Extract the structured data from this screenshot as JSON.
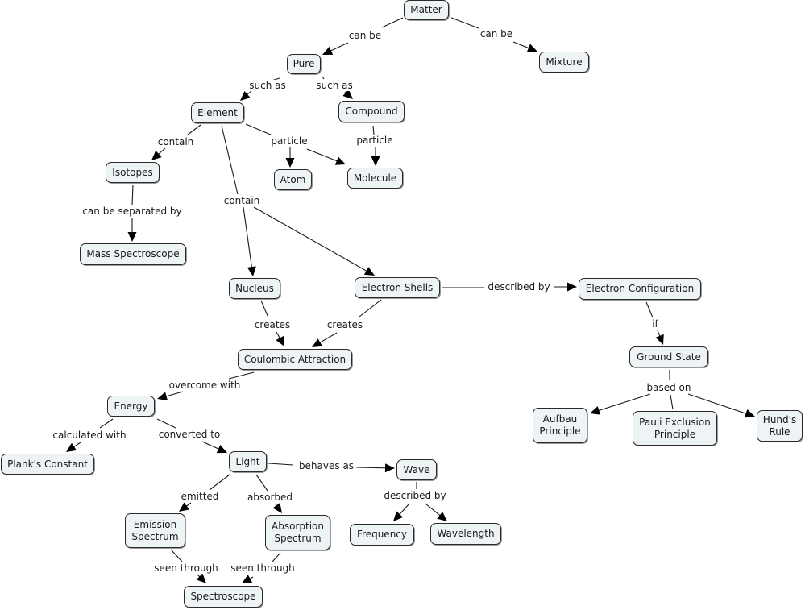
{
  "map": {
    "nodes": {
      "matter": "Matter",
      "pure": "Pure",
      "mixture": "Mixture",
      "element": "Element",
      "compound": "Compound",
      "isotopes": "Isotopes",
      "atom": "Atom",
      "molecule": "Molecule",
      "mass_spectroscope": "Mass Spectroscope",
      "nucleus": "Nucleus",
      "electron_shells": "Electron Shells",
      "electron_configuration": "Electron Configuration",
      "coulombic_attraction": "Coulombic Attraction",
      "ground_state": "Ground State",
      "energy": "Energy",
      "aufbau": "Aufbau\nPrinciple",
      "pauli": "Pauli Exclusion\nPrinciple",
      "hunds": "Hund's\nRule",
      "planks_constant": "Plank's Constant",
      "light": "Light",
      "wave": "Wave",
      "emission_spectrum": "Emission\nSpectrum",
      "absorption_spectrum": "Absorption\nSpectrum",
      "frequency": "Frequency",
      "wavelength": "Wavelength",
      "spectroscope": "Spectroscope"
    },
    "links": {
      "matter_pure": "can be",
      "matter_mixture": "can be",
      "pure_element": "such as",
      "pure_compound": "such as",
      "element_isotopes": "contain",
      "element_particle": "particle",
      "compound_particle": "particle",
      "isotopes_separated": "can be separated by",
      "element_contain": "contain",
      "shells_described": "described by",
      "nucleus_creates": "creates",
      "shells_creates": "creates",
      "config_if": "if",
      "ground_based_on": "based on",
      "coulombic_overcome": "overcome with",
      "energy_calculated": "calculated with",
      "energy_converted": "converted to",
      "light_behaves": "behaves as",
      "light_emitted": "emitted",
      "light_absorbed": "absorbed",
      "wave_described": "described by",
      "emission_seen": "seen through",
      "absorption_seen": "seen through"
    }
  }
}
